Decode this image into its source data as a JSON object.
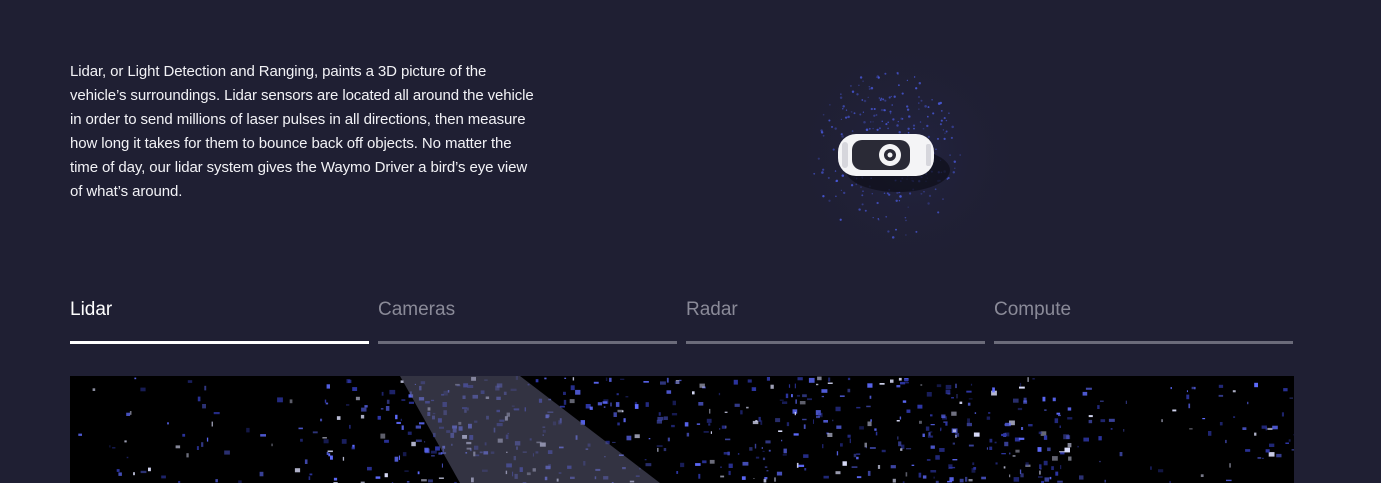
{
  "section": {
    "description": "Lidar, or Light Detection and Ranging, paints a 3D picture of the vehicle’s surroundings. Lidar sensors are located all around the vehicle in order to send millions of laser pulses in all directions, then measure how long it takes for them to bounce back off objects. No matter the time of day, our lidar system gives the Waymo Driver a bird’s eye view of what’s around."
  },
  "tabs": [
    {
      "label": "Lidar",
      "active": true
    },
    {
      "label": "Cameras",
      "active": false
    },
    {
      "label": "Radar",
      "active": false
    },
    {
      "label": "Compute",
      "active": false
    }
  ],
  "colors": {
    "background": "#1f1f33",
    "active_tab": "#ffffff",
    "inactive_tab": "#8a8a98",
    "lidar_points": "#4a5adf"
  }
}
